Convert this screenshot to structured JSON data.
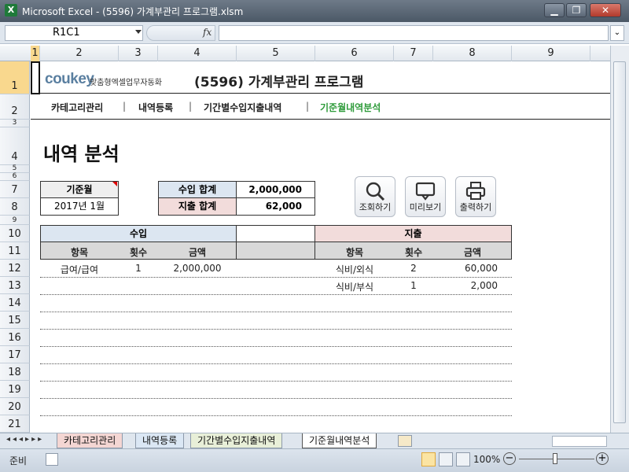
{
  "window": {
    "title": "Microsoft Excel - (5596) 가계부관리 프로그램.xlsm",
    "minimize": "▁",
    "restore": "❐",
    "close": "✕"
  },
  "formula_bar": {
    "name_box": "R1C1",
    "fx": "fx",
    "formula": ""
  },
  "columns": [
    "1",
    "2",
    "3",
    "4",
    "5",
    "6",
    "7",
    "8",
    "9"
  ],
  "rows": [
    "1",
    "2",
    "3",
    "4",
    "5",
    "6",
    "7",
    "8",
    "9",
    "10",
    "11",
    "12",
    "13",
    "14",
    "15",
    "16",
    "17",
    "18",
    "19",
    "20",
    "21"
  ],
  "header": {
    "logo": "coukey",
    "logo_sub": "맞춤형엑셀업무자동화",
    "program_title": "(5596) 가계부관리 프로그램"
  },
  "nav": {
    "items": [
      "카테고리관리",
      "내역등록",
      "기간별수입지출내역",
      "기준월내역분석"
    ],
    "separator": "|",
    "active_color": "#2e9b3a"
  },
  "page_title": "내역 분석",
  "criteria": {
    "label": "기준월",
    "value": "2017년 1월"
  },
  "summary": {
    "income_label": "수입 합계",
    "income_value": "2,000,000",
    "expense_label": "지출 합계",
    "expense_value": "62,000"
  },
  "buttons": {
    "search": "조회하기",
    "preview": "미리보기",
    "print": "출력하기"
  },
  "income_table": {
    "title": "수입",
    "headers": [
      "항목",
      "횟수",
      "금액"
    ],
    "rows": [
      {
        "item": "급여/급여",
        "count": "1",
        "amount": "2,000,000"
      }
    ]
  },
  "expense_table": {
    "title": "지출",
    "headers": [
      "항목",
      "횟수",
      "금액"
    ],
    "rows": [
      {
        "item": "식비/외식",
        "count": "2",
        "amount": "60,000"
      },
      {
        "item": "식비/부식",
        "count": "1",
        "amount": "2,000"
      }
    ]
  },
  "sheet_tabs": [
    "카테고리관리",
    "내역등록",
    "기간별수입지출내역",
    "기준월내역분석"
  ],
  "status": {
    "ready": "준비",
    "zoom": "100%"
  },
  "colors": {
    "income_header": "#dce6f1",
    "expense_header": "#f2dcdb",
    "subheader": "#d9d9d9"
  }
}
